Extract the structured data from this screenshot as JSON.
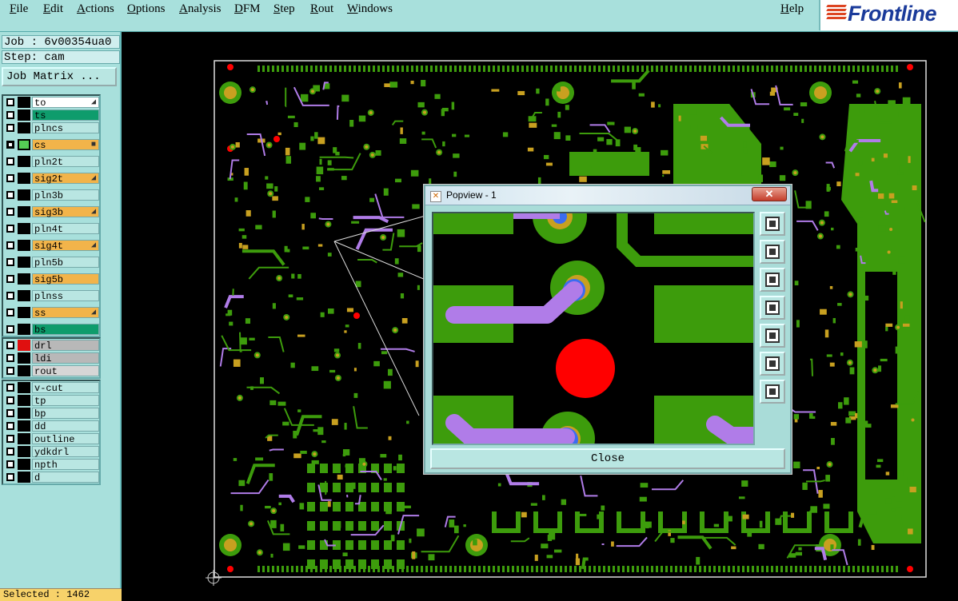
{
  "menubar": {
    "items": [
      "File",
      "Edit",
      "Actions",
      "Options",
      "Analysis",
      "DFM",
      "Step",
      "Rout",
      "Windows"
    ],
    "help": "Help",
    "logo_text": "Frontline"
  },
  "job": {
    "job_line": "Job : 6v00354ua0",
    "step_line": "Step: cam",
    "matrix_button": "Job Matrix ..."
  },
  "layers": {
    "group1": [
      {
        "name": "to",
        "color": "white",
        "mark": "◢",
        "checked": false
      },
      {
        "name": "ts",
        "color": "green",
        "mark": "",
        "checked": false
      },
      {
        "name": "plncs",
        "color": "",
        "mark": "",
        "checked": false
      },
      {
        "name": "cs",
        "color": "orange",
        "mark": "■",
        "checked": true,
        "active": true
      },
      {
        "name": "pln2t",
        "color": "",
        "mark": "",
        "checked": false
      },
      {
        "name": "sig2t",
        "color": "orange",
        "mark": "◢",
        "checked": false
      },
      {
        "name": "pln3b",
        "color": "",
        "mark": "",
        "checked": false
      },
      {
        "name": "sig3b",
        "color": "orange",
        "mark": "◢",
        "checked": false
      },
      {
        "name": "pln4t",
        "color": "",
        "mark": "",
        "checked": false
      },
      {
        "name": "sig4t",
        "color": "orange",
        "mark": "◢",
        "checked": false
      },
      {
        "name": "pln5b",
        "color": "",
        "mark": "",
        "checked": false
      },
      {
        "name": "sig5b",
        "color": "orange",
        "mark": "",
        "checked": false
      },
      {
        "name": "plnss",
        "color": "",
        "mark": "",
        "checked": false
      },
      {
        "name": "ss",
        "color": "orange",
        "mark": "◢",
        "checked": false
      },
      {
        "name": "bs",
        "color": "green",
        "mark": "",
        "checked": false
      }
    ],
    "group2": [
      {
        "name": "drl",
        "color": "gray",
        "swatch": "#e01010"
      },
      {
        "name": "ldi",
        "color": "gray",
        "swatch": "#000"
      },
      {
        "name": "rout",
        "color": "lgray",
        "swatch": "#000"
      }
    ],
    "group3": [
      "v-cut",
      "tp",
      "bp",
      "dd",
      "outline",
      "ydkdrl",
      "npth",
      "d"
    ]
  },
  "status": {
    "selected": "Selected : 1462"
  },
  "popview": {
    "title": "Popview - 1",
    "close_x": "✕",
    "close_button": "Close",
    "tools": [
      "zoom-window-icon",
      "pan-up-icon",
      "pan-down-icon",
      "pan-left-icon",
      "pan-right-icon",
      "zoom-fit-icon",
      "zoom-home-icon"
    ]
  },
  "colors": {
    "copper": "#3d9c0c",
    "pad_gold": "#c8a020",
    "trace_purple": "#b07ce8",
    "drill_red": "#ff0000",
    "via_blue": "#3c6cf0",
    "panel_bg": "#a8e0dc"
  }
}
